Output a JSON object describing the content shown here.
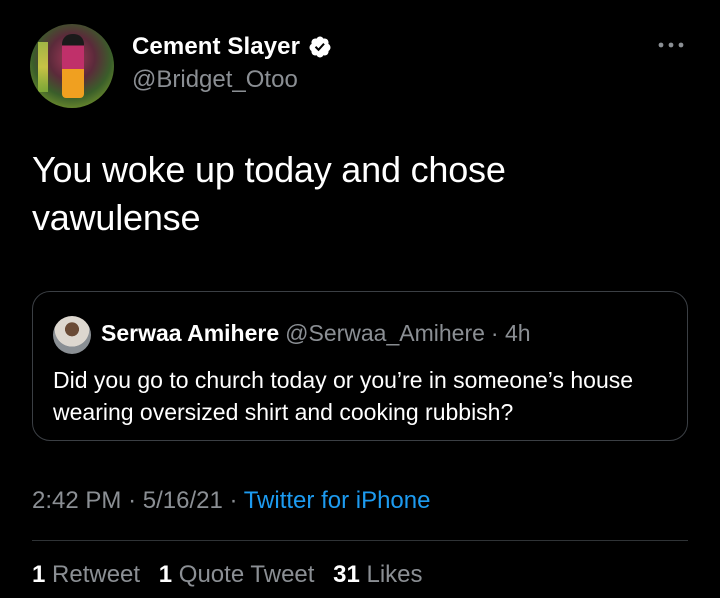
{
  "author": {
    "display_name": "Cement Slayer",
    "handle": "@Bridget_Otoo",
    "verified": true
  },
  "tweet": {
    "text": "You woke up today and chose vawulense"
  },
  "quoted_tweet": {
    "display_name": "Serwaa Amihere",
    "handle": "@Serwaa_Amihere",
    "age": "· 4h",
    "text": "Did you go to church today or you’re in someone’s house wearing oversized shirt and cooking rubbish?"
  },
  "meta": {
    "time": "2:42 PM",
    "sep1": "·",
    "date": "5/16/21",
    "sep2": "·",
    "source": "Twitter for iPhone"
  },
  "stats": {
    "retweets_count": "1",
    "retweets_label": "Retweet",
    "quotes_count": "1",
    "quotes_label": "Quote Tweet",
    "likes_count": "31",
    "likes_label": "Likes"
  },
  "colors": {
    "background": "#000000",
    "primary_text": "#ffffff",
    "secondary_text": "#8b8f94",
    "link": "#1d9bf0",
    "border": "#3b3f44"
  },
  "icons": {
    "verified": "verified-badge-icon",
    "more": "more-options-icon"
  }
}
